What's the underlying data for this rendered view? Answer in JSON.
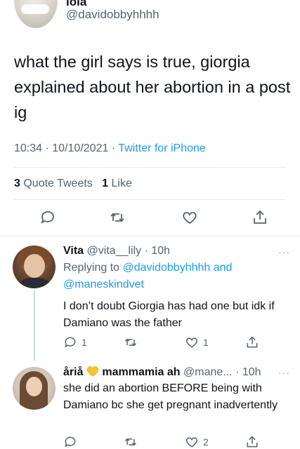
{
  "main_tweet": {
    "display_name": "lola",
    "handle": "@davidobbyhhhh",
    "text": "what the girl says is true, giorgia explained about her abortion in a post ig",
    "time": "10:34",
    "date": "10/10/2021",
    "source": "Twitter for iPhone",
    "dot": "·",
    "quote_count": "3",
    "quote_label": "Quote Tweets",
    "like_count": "1",
    "like_label": "Like",
    "more": "···"
  },
  "replies": [
    {
      "display_name": "Vita",
      "handle": "@vita__lily",
      "time": "· 10h",
      "replying_prefix": "Replying to",
      "replying_to_1": "@davidobbyhhhh",
      "replying_and": "and",
      "replying_to_2": "@maneskindvet",
      "text": "I don’t doubt Giorgia has had one but idk if Damiano was the father",
      "reply_count": "1",
      "retweet_count": "",
      "like_count": "1",
      "more": "···"
    },
    {
      "display_name": "åriå",
      "display_name_suffix": "mammamia ah",
      "handle": "@mane...",
      "time": "· 10h",
      "text": "she did an abortion BEFORE being with Damiano bc she get pregnant inadvertently",
      "reply_count": "",
      "retweet_count": "",
      "like_count": "2",
      "more": "···"
    }
  ],
  "colors": {
    "accent": "#1d9bf0",
    "secondary_text": "#536471",
    "divider": "#e6ecf0",
    "emoji_heart": "#f7c531"
  },
  "icons": [
    "reply-icon",
    "retweet-icon",
    "like-icon",
    "share-icon",
    "more-icon",
    "yellow-heart-emoji"
  ]
}
